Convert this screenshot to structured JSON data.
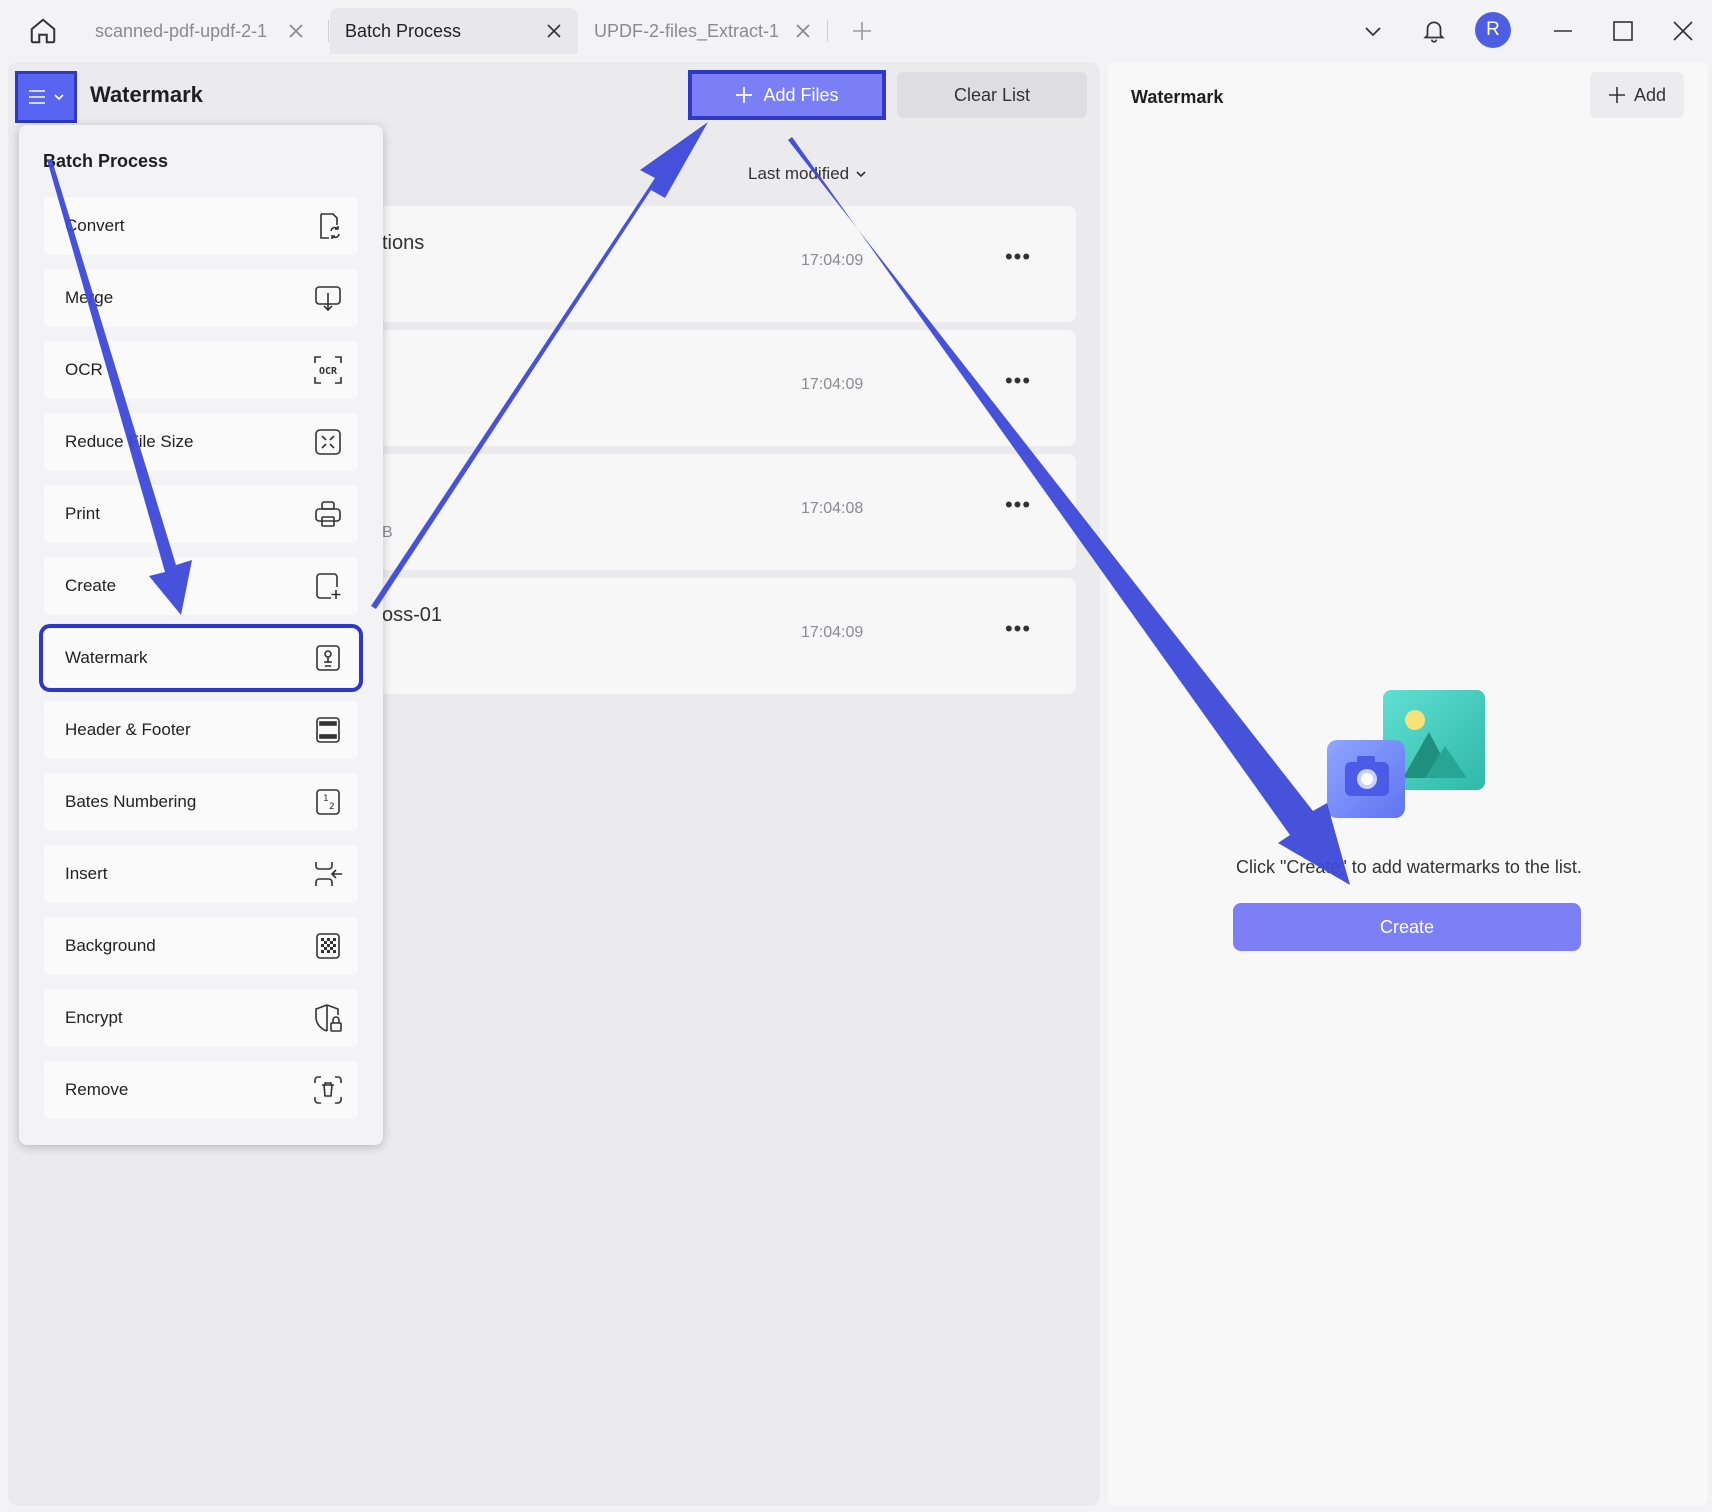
{
  "tabs": [
    {
      "label": "scanned-pdf-updf-2-1",
      "active": false
    },
    {
      "label": "Batch Process",
      "active": true
    },
    {
      "label": "UPDF-2-files_Extract-1",
      "active": false
    }
  ],
  "window": {
    "avatar_initial": "R"
  },
  "header": {
    "title": "Watermark"
  },
  "toolbar": {
    "add_files_label": "Add Files",
    "clear_list_label": "Clear List"
  },
  "sort": {
    "label": "Last modified"
  },
  "files": [
    {
      "name": "tions",
      "meta": "",
      "time": "17:04:09"
    },
    {
      "name": "",
      "meta": "",
      "time": "17:04:09"
    },
    {
      "name": "",
      "meta": "B",
      "time": "17:04:08"
    },
    {
      "name": "oss-01",
      "meta": "",
      "time": "17:04:09"
    }
  ],
  "menu": {
    "heading": "Batch Process",
    "items": [
      {
        "label": "Convert",
        "icon": "convert-icon"
      },
      {
        "label": "Merge",
        "icon": "merge-icon"
      },
      {
        "label": "OCR",
        "icon": "ocr-icon"
      },
      {
        "label": "Reduce File Size",
        "icon": "compress-icon"
      },
      {
        "label": "Print",
        "icon": "print-icon"
      },
      {
        "label": "Create",
        "icon": "create-icon"
      },
      {
        "label": "Watermark",
        "icon": "watermark-icon"
      },
      {
        "label": "Header & Footer",
        "icon": "header-footer-icon"
      },
      {
        "label": "Bates Numbering",
        "icon": "bates-numbering-icon"
      },
      {
        "label": "Insert",
        "icon": "insert-icon"
      },
      {
        "label": "Background",
        "icon": "background-icon"
      },
      {
        "label": "Encrypt",
        "icon": "encrypt-icon"
      },
      {
        "label": "Remove",
        "icon": "remove-icon"
      }
    ],
    "selected": "Watermark"
  },
  "right_panel": {
    "title": "Watermark",
    "add_label": "Add",
    "empty_message": "Click \"Create\" to add watermarks to the list.",
    "create_label": "Create"
  },
  "colors": {
    "accent": "#7c7ff6",
    "highlight": "#2e37c8",
    "avatar": "#4e5ee0"
  }
}
